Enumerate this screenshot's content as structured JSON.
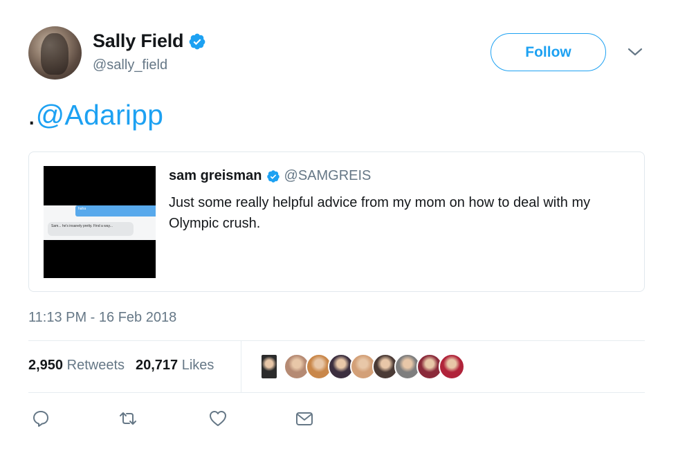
{
  "author": {
    "name": "Sally Field",
    "handle": "@sally_field",
    "verified": true
  },
  "follow": {
    "label": "Follow"
  },
  "tweet": {
    "prefix": ".",
    "mention": "@Adaripp"
  },
  "quote": {
    "name": "sam greisman",
    "handle": "@SAMGREIS",
    "text": "Just some really helpful advice from my mom on how to deal with my Olympic crush.",
    "media": {
      "bubble_sent": "haha",
      "bubble_received": "Sam... he's insanely pretty. Find a way..."
    }
  },
  "timestamp": "11:13 PM - 16 Feb 2018",
  "stats": {
    "retweets": {
      "count": "2,950",
      "label": "Retweets"
    },
    "likes": {
      "count": "20,717",
      "label": "Likes"
    }
  },
  "liker_colors": [
    "#2b2b2b",
    "#b58a73",
    "#c9874a",
    "#3c2f3f",
    "#d3a078",
    "#4a3a35",
    "#7e7e7e",
    "#8a2a3a",
    "#b0233a"
  ],
  "icons": [
    "reply-icon",
    "retweet-icon",
    "like-icon",
    "dm-icon",
    "chevron-down-icon",
    "verified-badge-icon"
  ],
  "colors": {
    "accent": "#1da1f2",
    "secondary_text": "#657786",
    "border": "#e1e8ed"
  }
}
